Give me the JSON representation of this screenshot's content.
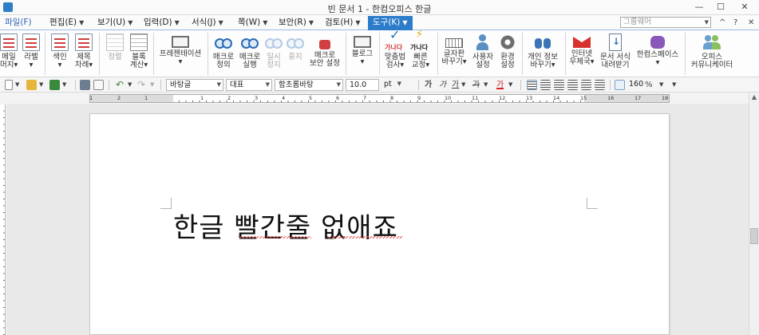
{
  "window": {
    "title": "빈 문서 1 - 한컴오피스 한글",
    "minimize": "—",
    "maximize": "☐",
    "close": "✕"
  },
  "menu": {
    "items": [
      "파일(F)",
      "편집(E)",
      "보기(U)",
      "입력(D)",
      "서식(J)",
      "쪽(W)",
      "보안(R)",
      "검토(H)",
      "도구(K)"
    ],
    "active_index": 8,
    "search_placeholder": "그룹웨어",
    "help_up": "^",
    "help_q": "?",
    "collapse": "∧",
    "close": "✕"
  },
  "ribbon": {
    "groups": [
      {
        "id": "mail-merge",
        "label": "메일\n머지▾"
      },
      {
        "id": "label",
        "label": "라벨\n▾"
      },
      {
        "id": "index",
        "label": "색인\n▾"
      },
      {
        "id": "toc",
        "label": "제목\n차례▾"
      },
      {
        "id": "sort",
        "label": "정렬"
      },
      {
        "id": "block-calc",
        "label": "블록\n계산▾"
      },
      {
        "id": "presentation",
        "label": "프레젠테이션\n▾"
      },
      {
        "id": "macro-define",
        "label": "매크로\n정의"
      },
      {
        "id": "macro-run",
        "label": "매크로\n실행"
      },
      {
        "id": "pause",
        "label": "일시\n정지"
      },
      {
        "id": "stop",
        "label": "중지"
      },
      {
        "id": "macro-security",
        "label": "매크로\n보안 설정"
      },
      {
        "id": "blog",
        "label": "블로그\n▾"
      },
      {
        "id": "spellcheck",
        "label": "맞춤법\n검사▾"
      },
      {
        "id": "quick-correct",
        "label": "빠른\n교정▾"
      },
      {
        "id": "keyboard-change",
        "label": "글자판\n바꾸기▾"
      },
      {
        "id": "user-settings",
        "label": "사용자\n설정"
      },
      {
        "id": "env-settings",
        "label": "환경\n설정"
      },
      {
        "id": "personal-info",
        "label": "개인 정보\n바꾸기▾"
      },
      {
        "id": "internet-mail",
        "label": "인터넷\n우체국▾"
      },
      {
        "id": "download-format",
        "label": "문서 서식\n내려받기"
      },
      {
        "id": "hancom-space",
        "label": "한컴스페이스\n▾"
      },
      {
        "id": "office-community",
        "label": "오피스\n커뮤니케이터"
      }
    ],
    "icon_text": {
      "spell": "가나다",
      "quick": "가나다"
    }
  },
  "format_bar": {
    "style": "바탕글",
    "language": "대표",
    "font": "함초롬바탕",
    "size": "10.0",
    "unit": "pt",
    "bold": "가",
    "italic": "가",
    "underline": "가",
    "strike": "가",
    "color_a": "가",
    "zoom": "160",
    "zoom_unit": "%"
  },
  "ruler": {
    "numbers": [
      "1",
      "2",
      "1",
      "1",
      "2",
      "3",
      "4",
      "5",
      "6",
      "7",
      "8",
      "9",
      "10",
      "11",
      "12",
      "13",
      "14",
      "15",
      "16",
      "17",
      "18"
    ]
  },
  "document": {
    "text": "한글 빨간줄 없애죠"
  },
  "colors": {
    "accent": "#2d7cc9",
    "spell_error": "#e4524a"
  }
}
